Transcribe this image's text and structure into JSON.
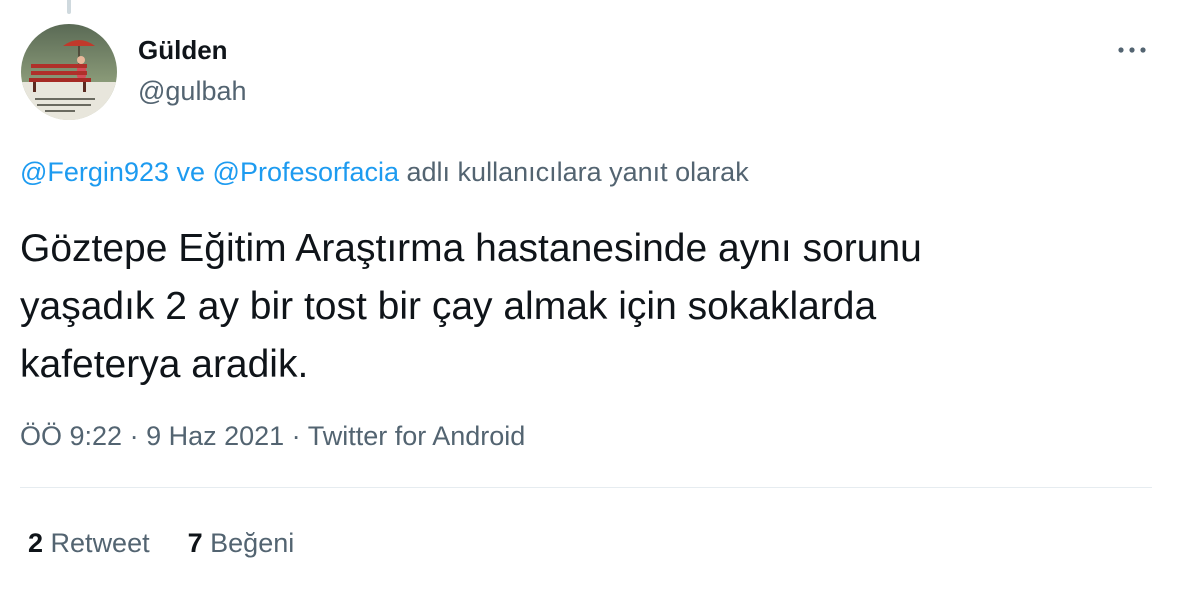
{
  "author": {
    "name": "Gülden",
    "handle": "@gulbah"
  },
  "reply_context": {
    "mention1": "@Fergin923",
    "connector": " ve ",
    "mention2": "@Profesorfacia",
    "suffix": " adlı kullanıcılara yanıt olarak"
  },
  "tweet": {
    "text": "Göztepe Eğitim Araştırma hastanesinde aynı sorunu\nyaşadık 2 ay bir tost bir çay almak için sokaklarda\nkafeterya aradik."
  },
  "meta": {
    "time": "ÖÖ 9:22",
    "separator": " · ",
    "date": "9 Haz 2021",
    "source": "Twitter for Android"
  },
  "stats": {
    "retweets_count": "2",
    "retweets_label": "Retweet",
    "likes_count": "7",
    "likes_label": "Beğeni"
  },
  "colors": {
    "link": "#1d9bf0",
    "secondary_text": "#536471",
    "primary_text": "#0f1419",
    "divider": "#e6ecf0"
  },
  "icons": {
    "more": "more-horizontal-icon"
  }
}
